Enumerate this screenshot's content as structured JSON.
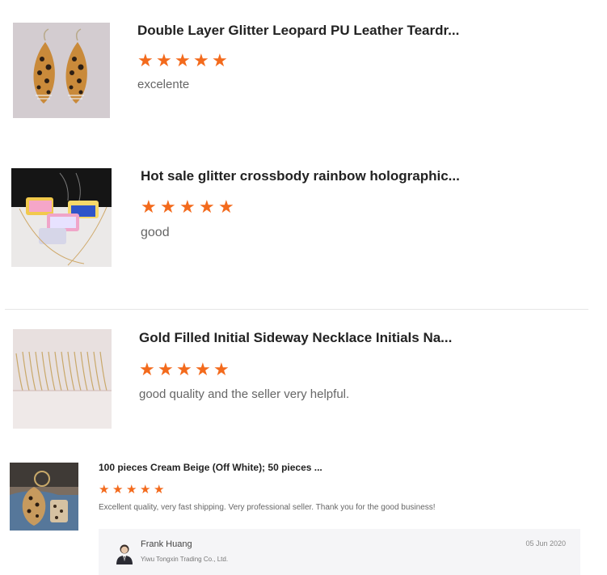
{
  "reviews": [
    {
      "title": "Double Layer Glitter Leopard PU Leather Teardr...",
      "rating": 5,
      "rating_stars": "★★★★★",
      "comment": "excelente",
      "thumbnail_icon": "leopard-earrings-image"
    },
    {
      "title": "Hot sale glitter crossbody rainbow holographic...",
      "rating": 5,
      "rating_stars": "★★★★★",
      "comment": "good",
      "thumbnail_icon": "holographic-bags-image"
    },
    {
      "title": "Gold Filled Initial Sideway Necklace Initials Na...",
      "rating": 5,
      "rating_stars": "★★★★★",
      "comment": "good quality and the seller very helpful.",
      "thumbnail_icon": "gold-necklaces-image"
    },
    {
      "title": "100 pieces Cream Beige (Off White); 50 pieces ...",
      "rating": 5,
      "rating_stars": "★★★★★",
      "comment": "Excellent quality, very fast shipping. Very professional seller. Thank you for the good business!",
      "thumbnail_icon": "leopard-keychain-image",
      "reviewer": {
        "name": "Frank Huang",
        "company": "Yiwu Tongxin Trading Co., Ltd.",
        "date": "05 Jun 2020"
      }
    }
  ],
  "colors": {
    "star": "#f36a1c",
    "divider": "#e6e6e6",
    "reply_background": "#f5f5f7"
  }
}
